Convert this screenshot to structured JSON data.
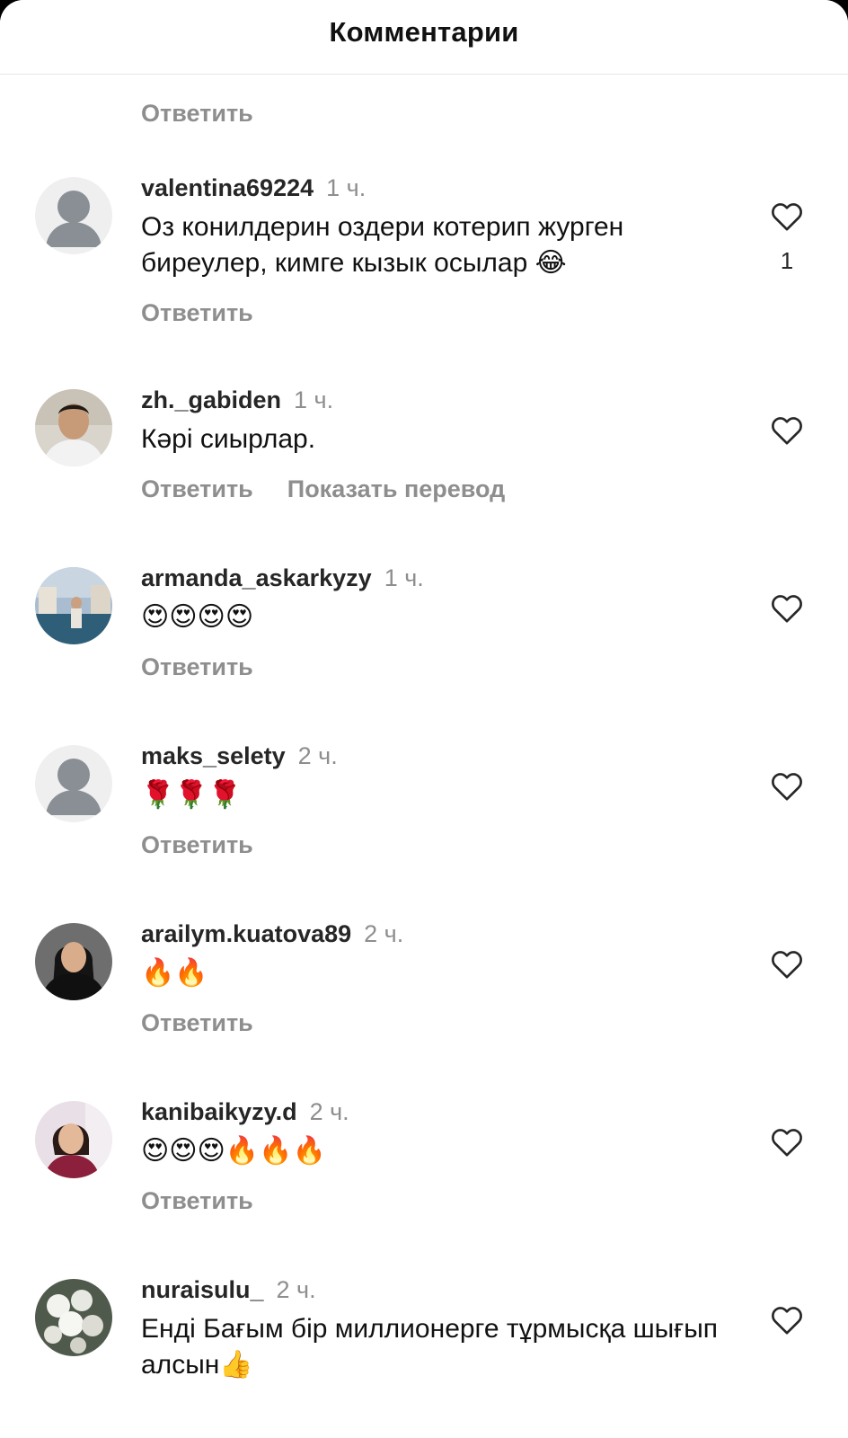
{
  "header": {
    "title": "Комментарии"
  },
  "top_reply_label": "Ответить",
  "comments": [
    {
      "username": "valentina69224",
      "time": "1 ч.",
      "text": "Оз конилдерин оздери котерип журген биреулер, кимге кызык осылар 😂",
      "reply_label": "Ответить",
      "like_count": "1",
      "avatar": "default-avatar"
    },
    {
      "username": "zh._gabiden",
      "time": "1 ч.",
      "text": "Кәрі сиырлар.",
      "reply_label": "Ответить",
      "translate_label": "Показать перевод",
      "avatar": "photo-avatar"
    },
    {
      "username": "armanda_askarkyzy",
      "time": "1 ч.",
      "text": "😍😍😍😍",
      "reply_label": "Ответить",
      "avatar": "photo-avatar"
    },
    {
      "username": "maks_selety",
      "time": "2 ч.",
      "text": "🌹🌹🌹",
      "reply_label": "Ответить",
      "avatar": "default-avatar"
    },
    {
      "username": "arailym.kuatova89",
      "time": "2 ч.",
      "text": "🔥🔥",
      "reply_label": "Ответить",
      "avatar": "photo-avatar"
    },
    {
      "username": "kanibaikyzy.d",
      "time": "2 ч.",
      "text": "😍😍😍🔥🔥🔥",
      "reply_label": "Ответить",
      "avatar": "photo-avatar"
    },
    {
      "username": "nuraisulu_",
      "time": "2 ч.",
      "text": "Енді Бағым бір миллионерге тұрмысқа шығып алсын👍",
      "avatar": "photo-avatar"
    }
  ],
  "colors": {
    "username": "#262626",
    "muted": "#8e8e8e",
    "text": "#111111",
    "background": "#ffffff"
  },
  "icons": [
    "heart-outline-icon",
    "default-avatar-icon"
  ]
}
